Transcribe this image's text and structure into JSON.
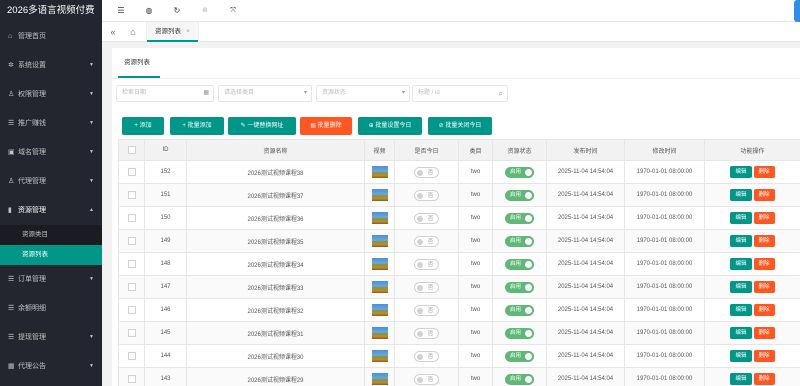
{
  "app_title": "2026多语言视频付费",
  "sidebar": {
    "items": [
      {
        "label": "管理首页",
        "icon": "home-icon",
        "glyph": "⌂",
        "arrow": false
      },
      {
        "label": "系统设置",
        "icon": "gear-icon",
        "glyph": "✲",
        "arrow": true
      },
      {
        "label": "权限管理",
        "icon": "users-icon",
        "glyph": "♙",
        "arrow": true
      },
      {
        "label": "推广赚钱",
        "icon": "list-icon",
        "glyph": "☰",
        "arrow": true
      },
      {
        "label": "域名管理",
        "icon": "domain-icon",
        "glyph": "▣",
        "arrow": true
      },
      {
        "label": "代理管理",
        "icon": "agent-icon",
        "glyph": "♙",
        "arrow": true
      },
      {
        "label": "资源管理",
        "icon": "resource-icon",
        "glyph": "▮",
        "arrow": true,
        "open": true
      },
      {
        "label": "订单管理",
        "icon": "order-icon",
        "glyph": "☰",
        "arrow": true
      },
      {
        "label": "余额明细",
        "icon": "balance-icon",
        "glyph": "☰",
        "arrow": false
      },
      {
        "label": "提现管理",
        "icon": "withdraw-icon",
        "glyph": "☰",
        "arrow": true
      },
      {
        "label": "代理公告",
        "icon": "notice-icon",
        "glyph": "▦",
        "arrow": true
      }
    ],
    "submenu": [
      {
        "label": "资源类目",
        "active": false
      },
      {
        "label": "资源列表",
        "active": true
      }
    ]
  },
  "header": {
    "icons": [
      "menu-icon",
      "globe-icon",
      "refresh-icon",
      "clear-icon",
      "fullscreen-icon"
    ]
  },
  "tabsbar": {
    "tab_label": "资源列表",
    "close": "×"
  },
  "card": {
    "tab_label": "资源列表"
  },
  "filters": {
    "date_placeholder": "检索日期",
    "category_placeholder": "请选择类目",
    "status_placeholder": "资源状态",
    "keyword_placeholder": "标题 / id"
  },
  "buttons": {
    "add": "+ 添加",
    "batch_add": "+ 批量添加",
    "replace_url": "✎ 一键替换网址",
    "batch_delete": "▤ 批量删除",
    "batch_set_today": "⊕ 批量设置今日",
    "batch_close_today": "⊘ 批量关闭今日"
  },
  "table": {
    "headers": [
      "",
      "ID",
      "资源名称",
      "视频",
      "是否今日",
      "类目",
      "资源状态",
      "发布时间",
      "修改时间",
      "功能操作"
    ],
    "today_off": "否",
    "status_on": "启用",
    "edit": "编辑",
    "delete": "删除",
    "rows": [
      {
        "id": "152",
        "name": "2026测试视频课程38",
        "category": "two",
        "publish": "2025-11-04 14:54:04",
        "modified": "1970-01-01 08:00:00"
      },
      {
        "id": "151",
        "name": "2026测试视频课程37",
        "category": "two",
        "publish": "2025-11-04 14:54:04",
        "modified": "1970-01-01 08:00:00"
      },
      {
        "id": "150",
        "name": "2026测试视频课程36",
        "category": "two",
        "publish": "2025-11-04 14:54:04",
        "modified": "1970-01-01 08:00:00"
      },
      {
        "id": "149",
        "name": "2026测试视频课程35",
        "category": "two",
        "publish": "2025-11-04 14:54:04",
        "modified": "1970-01-01 08:00:00"
      },
      {
        "id": "148",
        "name": "2026测试视频课程34",
        "category": "two",
        "publish": "2025-11-04 14:54:04",
        "modified": "1970-01-01 08:00:00"
      },
      {
        "id": "147",
        "name": "2026测试视频课程33",
        "category": "two",
        "publish": "2025-11-04 14:54:04",
        "modified": "1970-01-01 08:00:00"
      },
      {
        "id": "146",
        "name": "2026测试视频课程32",
        "category": "two",
        "publish": "2025-11-04 14:54:04",
        "modified": "1970-01-01 08:00:00"
      },
      {
        "id": "145",
        "name": "2026测试视频课程31",
        "category": "two",
        "publish": "2025-11-04 14:54:04",
        "modified": "1970-01-01 08:00:00"
      },
      {
        "id": "144",
        "name": "2026测试视频课程30",
        "category": "two",
        "publish": "2025-11-04 14:54:04",
        "modified": "1970-01-01 08:00:00"
      },
      {
        "id": "143",
        "name": "2026测试视频课程29",
        "category": "two",
        "publish": "2025-11-04 14:54:04",
        "modified": "1970-01-01 08:00:00"
      }
    ]
  },
  "colors": {
    "sidebar_bg": "#23262e",
    "accent": "#009688",
    "danger": "#ff5722",
    "switch_on": "#5fb878"
  }
}
